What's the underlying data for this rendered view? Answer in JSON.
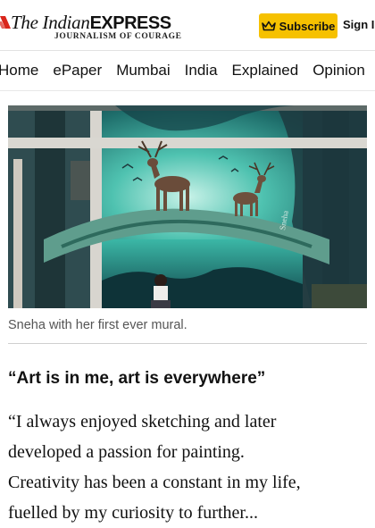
{
  "header": {
    "logo": {
      "prefix": "The Indian",
      "brand": "EXPRESS",
      "tagline": "JOURNALISM OF COURAGE"
    },
    "subscribe_label": "Subscribe",
    "signin_label": "Sign In",
    "accent_color": "#f6c100",
    "logo_mark_color": "#d9261c"
  },
  "nav": {
    "items": [
      "Home",
      "ePaper",
      "Mumbai",
      "India",
      "Explained",
      "Opinion"
    ]
  },
  "article": {
    "image_alt": "Sneha with her first ever mural.",
    "caption": "Sneha with her first ever mural.",
    "subheading": "“Art is in me, art is everywhere”",
    "body_lines": [
      "“I always enjoyed sketching and later",
      "developed a passion for painting.",
      "Creativity has been a constant in my life,",
      "fuelled by my curiosity to further..."
    ]
  }
}
